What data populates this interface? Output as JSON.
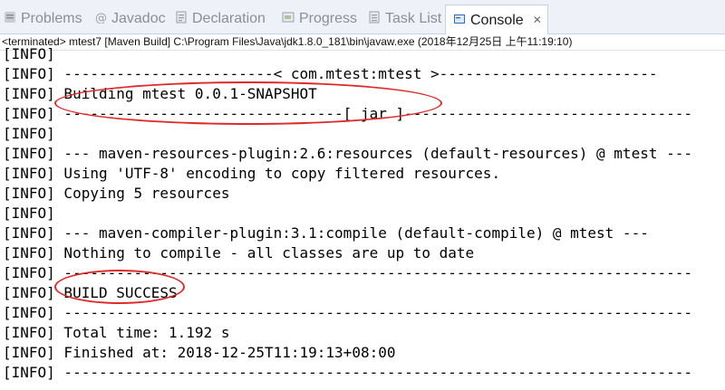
{
  "tabs": [
    {
      "label": "Problems",
      "icon": "problems-icon"
    },
    {
      "label": "Javadoc",
      "icon": "javadoc-icon"
    },
    {
      "label": "Declaration",
      "icon": "declaration-icon"
    },
    {
      "label": "Progress",
      "icon": "progress-icon"
    },
    {
      "label": "Task List",
      "icon": "task-list-icon"
    },
    {
      "label": "Console",
      "icon": "console-icon",
      "active": true,
      "close": "✕"
    }
  ],
  "status_line": "<terminated> mtest7 [Maven Build] C:\\Program Files\\Java\\jdk1.8.0_181\\bin\\javaw.exe (2018年12月25日 上午11:19:10)",
  "console_lines": [
    "[INFO]",
    "[INFO] ------------------------< com.mtest:mtest >-------------------------",
    "[INFO] Building mtest 0.0.1-SNAPSHOT",
    "[INFO] --------------------------------[ jar ]---------------------------------",
    "[INFO]",
    "[INFO] --- maven-resources-plugin:2.6:resources (default-resources) @ mtest ---",
    "[INFO] Using 'UTF-8' encoding to copy filtered resources.",
    "[INFO] Copying 5 resources",
    "[INFO]",
    "[INFO] --- maven-compiler-plugin:3.1:compile (default-compile) @ mtest ---",
    "[INFO] Nothing to compile - all classes are up to date",
    "[INFO] ------------------------------------------------------------------------",
    "[INFO] BUILD SUCCESS",
    "[INFO] ------------------------------------------------------------------------",
    "[INFO] Total time: 1.192 s",
    "[INFO] Finished at: 2018-12-25T11:19:13+08:00",
    "[INFO] ------------------------------------------------------------------------"
  ],
  "colors": {
    "annotation": "#e02a2a",
    "tabbar_bg": "#eef2f8",
    "console_text": "#000000"
  }
}
